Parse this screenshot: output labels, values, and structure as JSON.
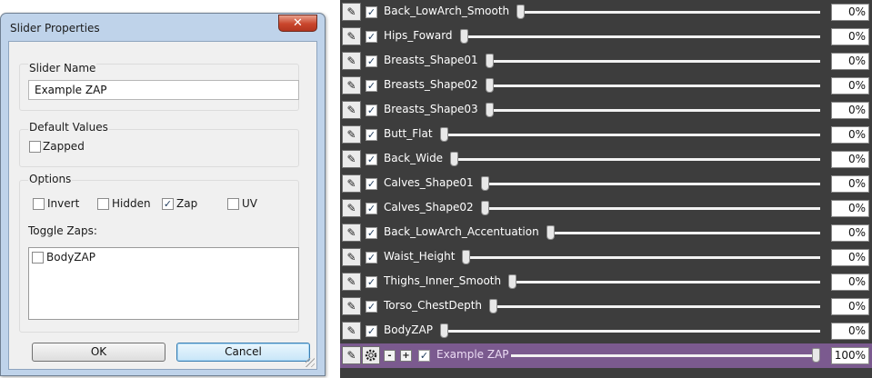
{
  "dialog": {
    "title": "Slider Properties",
    "close_label": "✕",
    "slider_name_label": "Slider Name",
    "slider_name_value": "Example ZAP",
    "default_values_label": "Default Values",
    "zapped_label": "Zapped",
    "options_label": "Options",
    "invert_label": "Invert",
    "hidden_label": "Hidden",
    "zap_label": "Zap",
    "uv_label": "UV",
    "toggle_zaps_label": "Toggle Zaps:",
    "toggle_zaps_items": [
      {
        "label": "BodyZAP",
        "checked": false
      }
    ],
    "ok_label": "OK",
    "cancel_label": "Cancel",
    "checks": {
      "zapped": false,
      "invert": false,
      "hidden": false,
      "zap": true,
      "uv": false
    }
  },
  "sliders": [
    {
      "name": "Back_LowArch_Smooth",
      "value": "0%",
      "level": 0.0,
      "checked": true
    },
    {
      "name": "Hips_Foward",
      "value": "0%",
      "level": 0.0,
      "checked": true
    },
    {
      "name": "Breasts_Shape01",
      "value": "0%",
      "level": 0.0,
      "checked": true
    },
    {
      "name": "Breasts_Shape02",
      "value": "0%",
      "level": 0.0,
      "checked": true
    },
    {
      "name": "Breasts_Shape03",
      "value": "0%",
      "level": 0.0,
      "checked": true
    },
    {
      "name": "Butt_Flat",
      "value": "0%",
      "level": 0.0,
      "checked": true
    },
    {
      "name": "Back_Wide",
      "value": "0%",
      "level": 0.0,
      "checked": true
    },
    {
      "name": "Calves_Shape01",
      "value": "0%",
      "level": 0.0,
      "checked": true
    },
    {
      "name": "Calves_Shape02",
      "value": "0%",
      "level": 0.0,
      "checked": true
    },
    {
      "name": "Back_LowArch_Accentuation",
      "value": "0%",
      "level": 0.0,
      "checked": true
    },
    {
      "name": "Waist_Height",
      "value": "0%",
      "level": 0.0,
      "checked": true
    },
    {
      "name": "Thighs_Inner_Smooth",
      "value": "0%",
      "level": 0.0,
      "checked": true
    },
    {
      "name": "Torso_ChestDepth",
      "value": "0%",
      "level": 0.0,
      "checked": true
    },
    {
      "name": "BodyZAP",
      "value": "0%",
      "level": 0.0,
      "checked": true
    }
  ],
  "active_slider": {
    "name": "Example ZAP",
    "value": "100%",
    "level": 1.0,
    "checked": true,
    "minus_label": "-",
    "plus_label": "+"
  },
  "icons": {
    "edit": "pencil-icon",
    "settings": "gear-icon"
  },
  "colors": {
    "panel_bg": "#3d3d3d",
    "active_row": "#7b5a8f",
    "dialog_frame": "#bfd3ea"
  }
}
